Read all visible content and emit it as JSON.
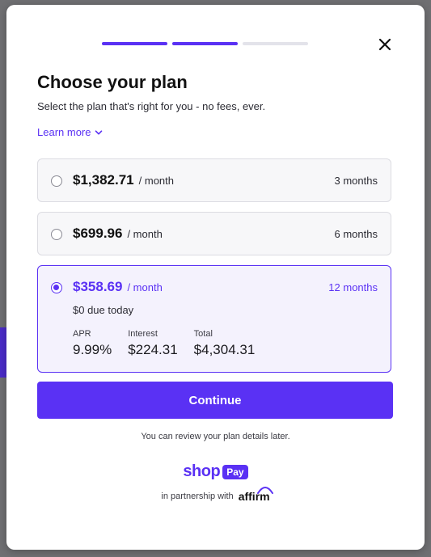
{
  "progress": {
    "total_steps": 3,
    "completed_steps": 2
  },
  "header": {
    "title": "Choose your plan",
    "subtitle": "Select the plan that's right for you - no fees, ever.",
    "learn_more": "Learn more"
  },
  "plans": [
    {
      "amount": "$1,382.71",
      "per": "/ month",
      "term": "3 months",
      "selected": false
    },
    {
      "amount": "$699.96",
      "per": "/ month",
      "term": "6 months",
      "selected": false
    },
    {
      "amount": "$358.69",
      "per": "/ month",
      "term": "12 months",
      "selected": true,
      "due_today": "$0 due today",
      "details": [
        {
          "label": "APR",
          "value": "9.99%"
        },
        {
          "label": "Interest",
          "value": "$224.31"
        },
        {
          "label": "Total",
          "value": "$4,304.31"
        }
      ]
    }
  ],
  "actions": {
    "continue_label": "Continue"
  },
  "footer": {
    "review_note": "You can review your plan details later.",
    "brand_shop": "shop",
    "brand_pay": "Pay",
    "partnership": "in partnership with",
    "partner_name": "affirm"
  },
  "colors": {
    "accent": "#5a31f4",
    "progress_inactive": "#e3e3ea"
  },
  "icons": {
    "close": "close-icon",
    "learn_more": "chevron-down-icon",
    "radio": "radio-button"
  }
}
